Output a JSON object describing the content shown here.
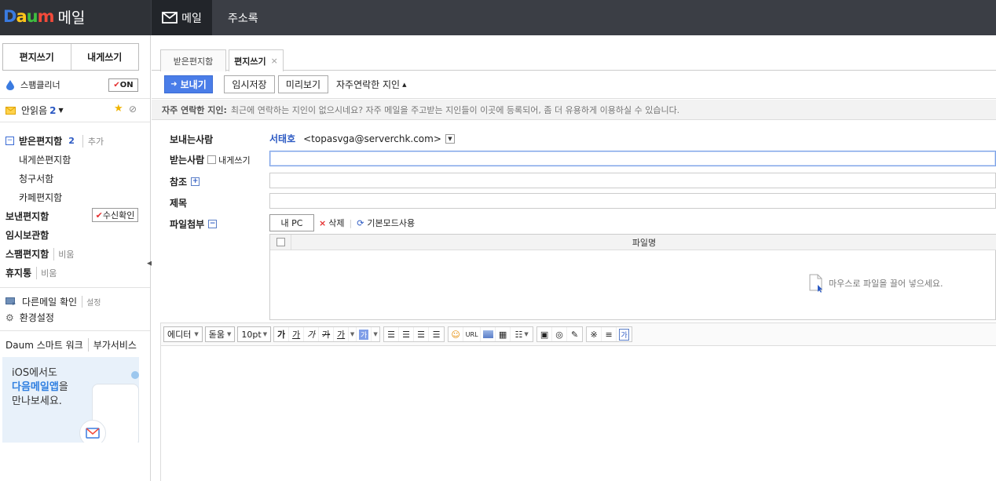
{
  "app": {
    "logo_text": "Daum",
    "title": "메일"
  },
  "topnav": {
    "mail_label": "메일",
    "address_label": "주소록"
  },
  "sidebar": {
    "write_label": "편지쓰기",
    "write_me_label": "내게쓰기",
    "spam_cleaner_label": "스팸클리너",
    "spam_cleaner_toggle": "ON",
    "unread_label": "안읽음",
    "unread_count": "2",
    "inbox_label": "받은편지함",
    "inbox_count": "2",
    "inbox_add": "추가",
    "self_box": "내게쓴편지함",
    "bill_box": "청구서함",
    "cafe_box": "카페편지함",
    "sent_box": "보낸편지함",
    "read_receipt": "수신확인",
    "drafts_box": "임시보관함",
    "spam_box": "스팸편지함",
    "spam_empty": "비움",
    "trash_box": "휴지통",
    "trash_empty": "비움",
    "other_mail": "다른메일 확인",
    "other_mail_settings": "설정",
    "settings": "환경설정",
    "daum_smart_work": "Daum 스마트 워크",
    "extra_services": "부가서비스",
    "promo_line1": "iOS에서도",
    "promo_line2": "다음메일앱",
    "promo_line2_suffix": "을",
    "promo_line3": "만나보세요."
  },
  "tabs": [
    {
      "label": "받은편지함"
    },
    {
      "label": "편지쓰기",
      "close": "×"
    }
  ],
  "toolbar": {
    "send_label": "보내기",
    "draft_label": "임시저장",
    "preview_label": "미리보기",
    "frequent_label": "자주연락한 지인"
  },
  "frequent_info": {
    "title": "자주 연락한 지인:",
    "message": "최근에 연락하는 지인이 없으시네요? 자주 메일을 주고받는 지인들이 이곳에 등록되어, 좀 더 유용하게 이용하실 수 있습니다."
  },
  "form": {
    "sender_label": "보내는사람",
    "sender_name": "서태호",
    "sender_email": "<topasvga@serverchk.com>",
    "to_label": "받는사람",
    "to_self_label": "내게쓰기",
    "cc_label": "참조",
    "subject_label": "제목",
    "attach_label": "파일첨부",
    "my_pc_label": "내 PC",
    "delete_label": "삭제",
    "basic_mode_label": "기본모드사용",
    "file_name_header": "파일명",
    "drop_hint": "마우스로 파일을 끌어 넣으세요."
  },
  "editor": {
    "mode": "에디터",
    "font": "돋움",
    "size": "10pt",
    "bold": "가",
    "underline": "가",
    "italic": "가",
    "strike": "가",
    "fontcolor": "가",
    "bgcolor": "가",
    "url": "URL",
    "special": "※",
    "hr": "≡",
    "extra": "가"
  },
  "colors": {
    "topbar": "#3b3e45",
    "accent_blue": "#4a7de8",
    "daum_blue": "#2b59c3"
  }
}
